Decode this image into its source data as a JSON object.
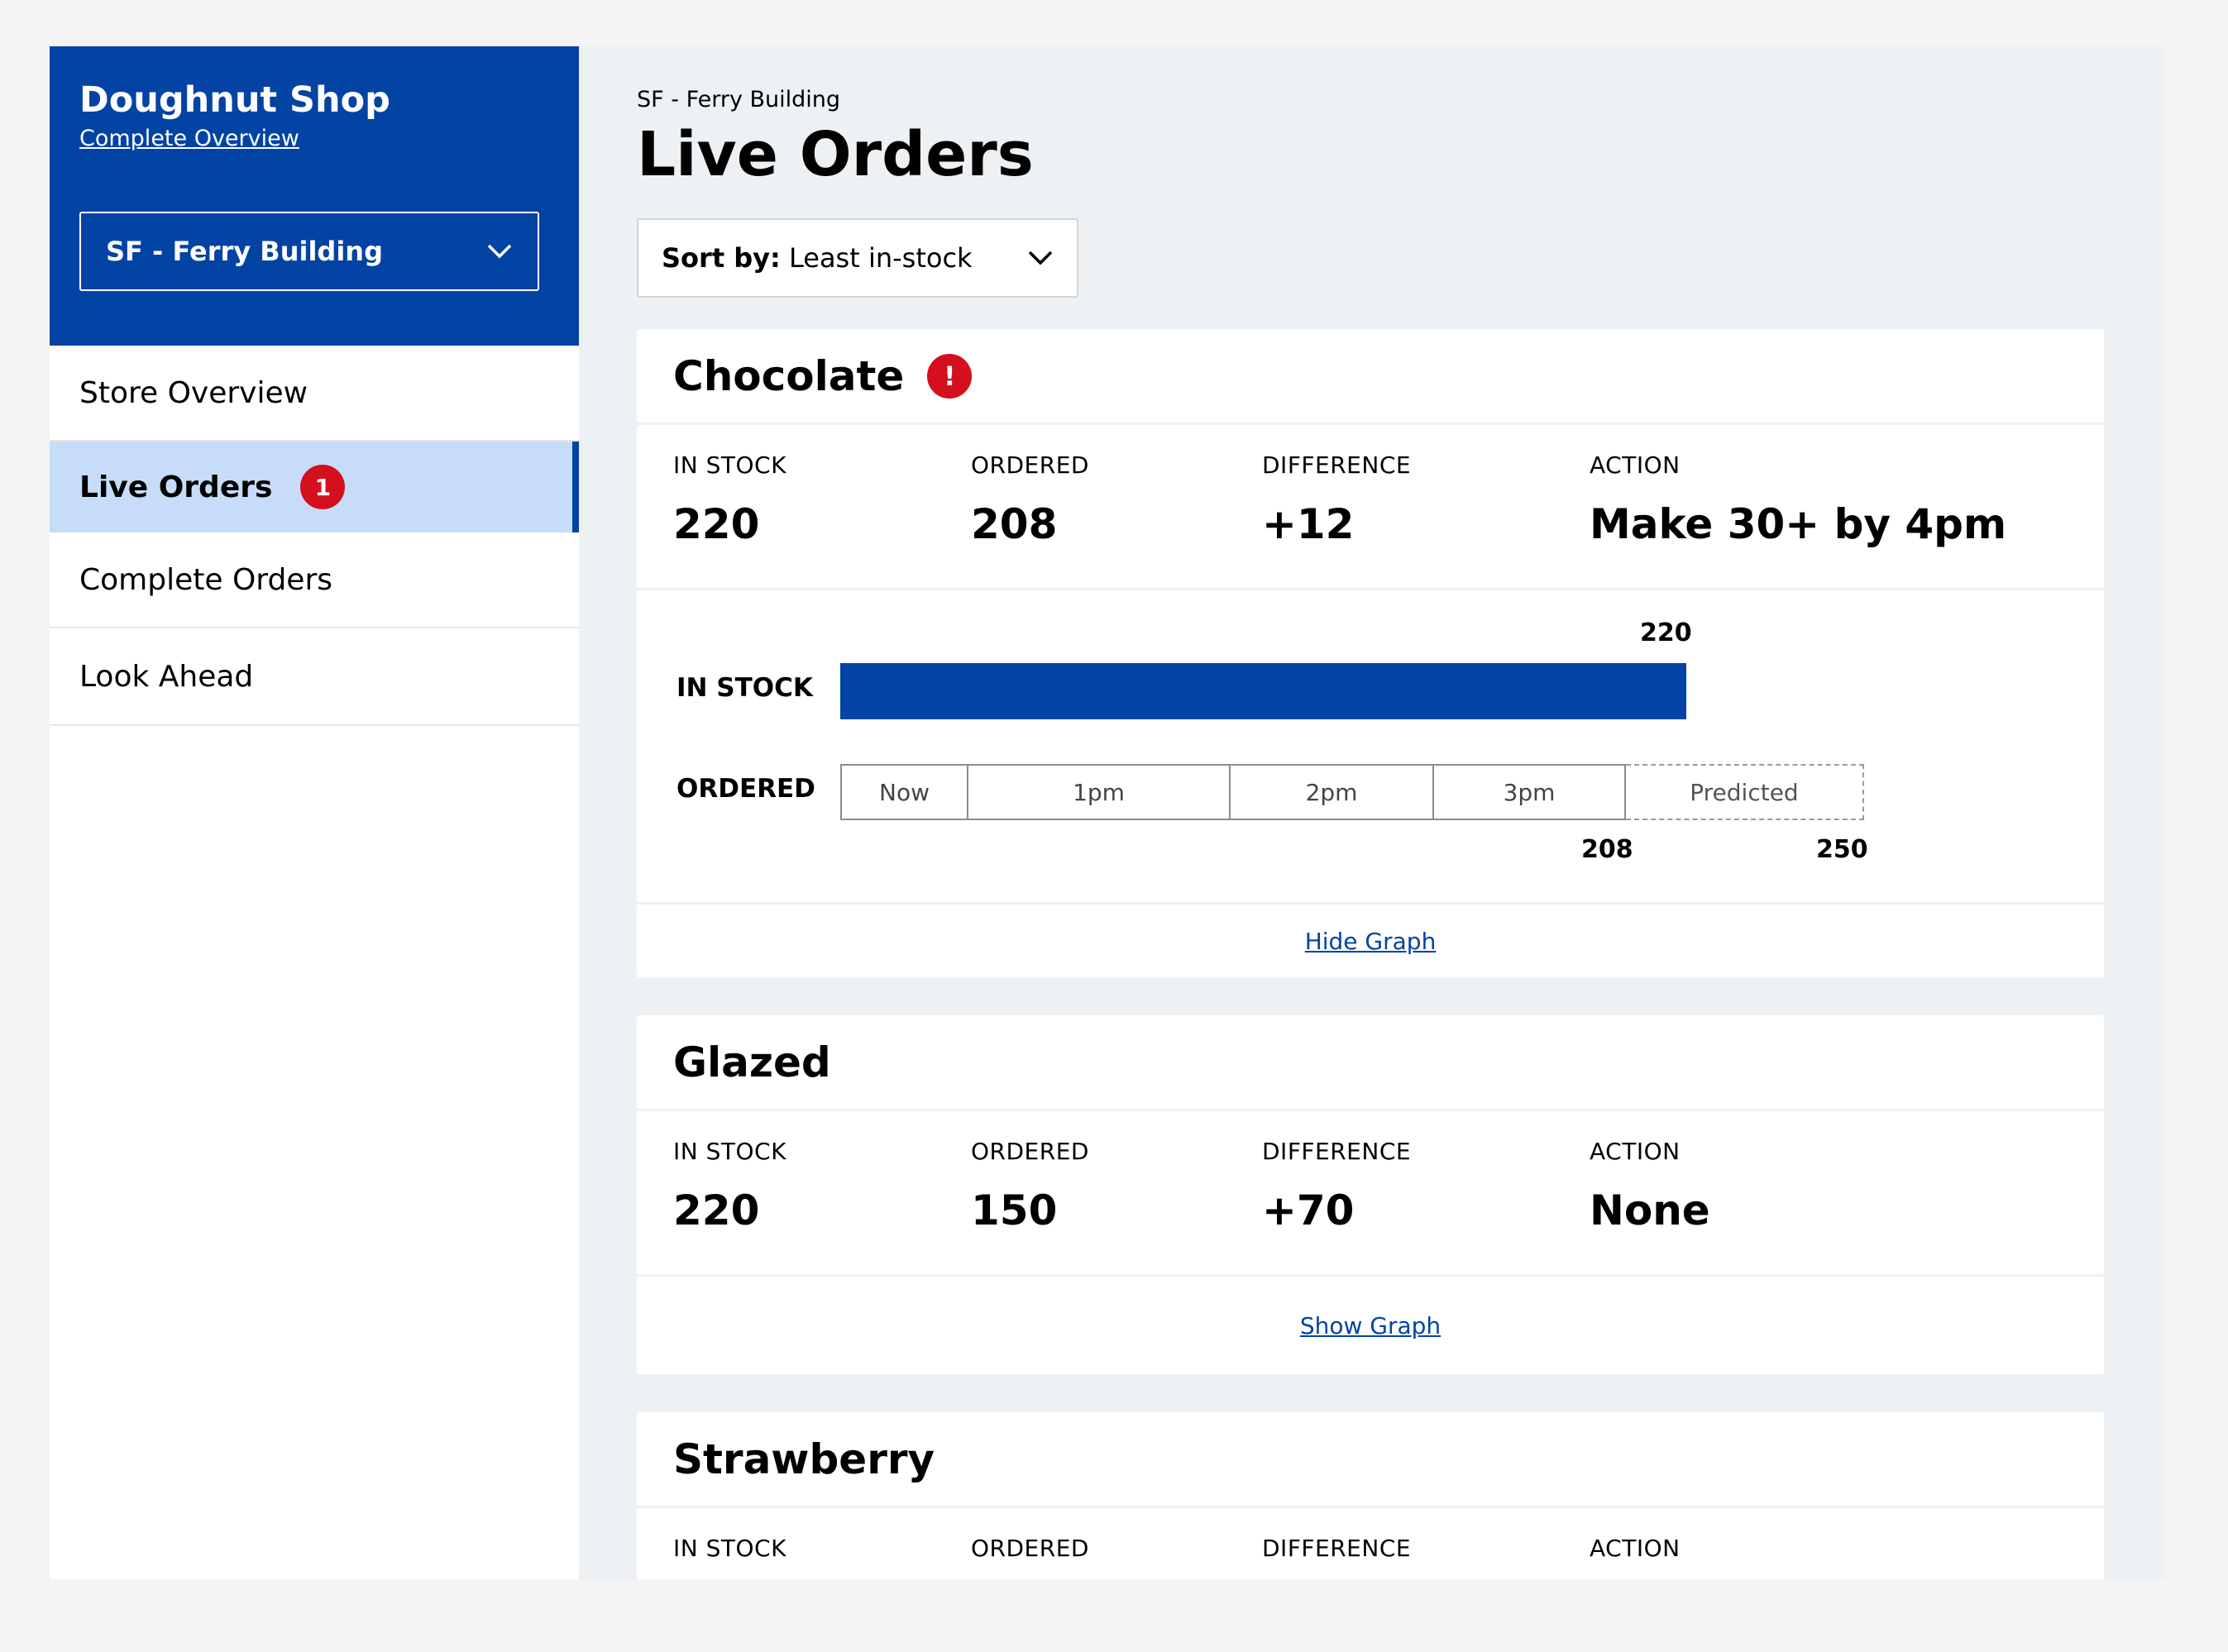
{
  "sidebar": {
    "shop_title": "Doughnut Shop",
    "overview_link": "Complete Overview",
    "store_select": "SF - Ferry Building",
    "nav": [
      {
        "label": "Store Overview"
      },
      {
        "label": "Live Orders",
        "badge": "1",
        "active": true
      },
      {
        "label": "Complete Orders"
      },
      {
        "label": "Look Ahead"
      }
    ]
  },
  "main": {
    "breadcrumb": "SF - Ferry Building",
    "title": "Live Orders",
    "sort": {
      "prefix": "Sort by:",
      "value": "Least in-stock"
    },
    "stat_labels": {
      "in_stock": "IN STOCK",
      "ordered": "ORDERED",
      "difference": "DIFFERENCE",
      "action": "ACTION"
    },
    "cards": [
      {
        "name": "Chocolate",
        "alert": "!",
        "in_stock": "220",
        "ordered": "208",
        "difference": "+12",
        "action": "Make 30+ by 4pm",
        "graph": {
          "in_stock_label": "IN STOCK",
          "ordered_label": "ORDERED",
          "in_stock_value": "220",
          "ordered_value": "208",
          "predicted_value": "250",
          "segments": [
            "Now",
            "1pm",
            "2pm",
            "3pm"
          ],
          "predicted_label": "Predicted"
        },
        "toggle": "Hide Graph"
      },
      {
        "name": "Glazed",
        "in_stock": "220",
        "ordered": "150",
        "difference": "+70",
        "action": "None",
        "toggle": "Show Graph"
      },
      {
        "name": "Strawberry"
      }
    ]
  },
  "colors": {
    "brand": "#0343a4",
    "active_nav": "#c7dcf8",
    "alert": "#d40f1e"
  },
  "chart_data": {
    "type": "bar",
    "categories": [
      "IN STOCK",
      "ORDERED"
    ],
    "values": [
      220,
      208
    ],
    "ordered_breakdown": [
      "Now",
      "1pm",
      "2pm",
      "3pm"
    ],
    "predicted": 250
  }
}
